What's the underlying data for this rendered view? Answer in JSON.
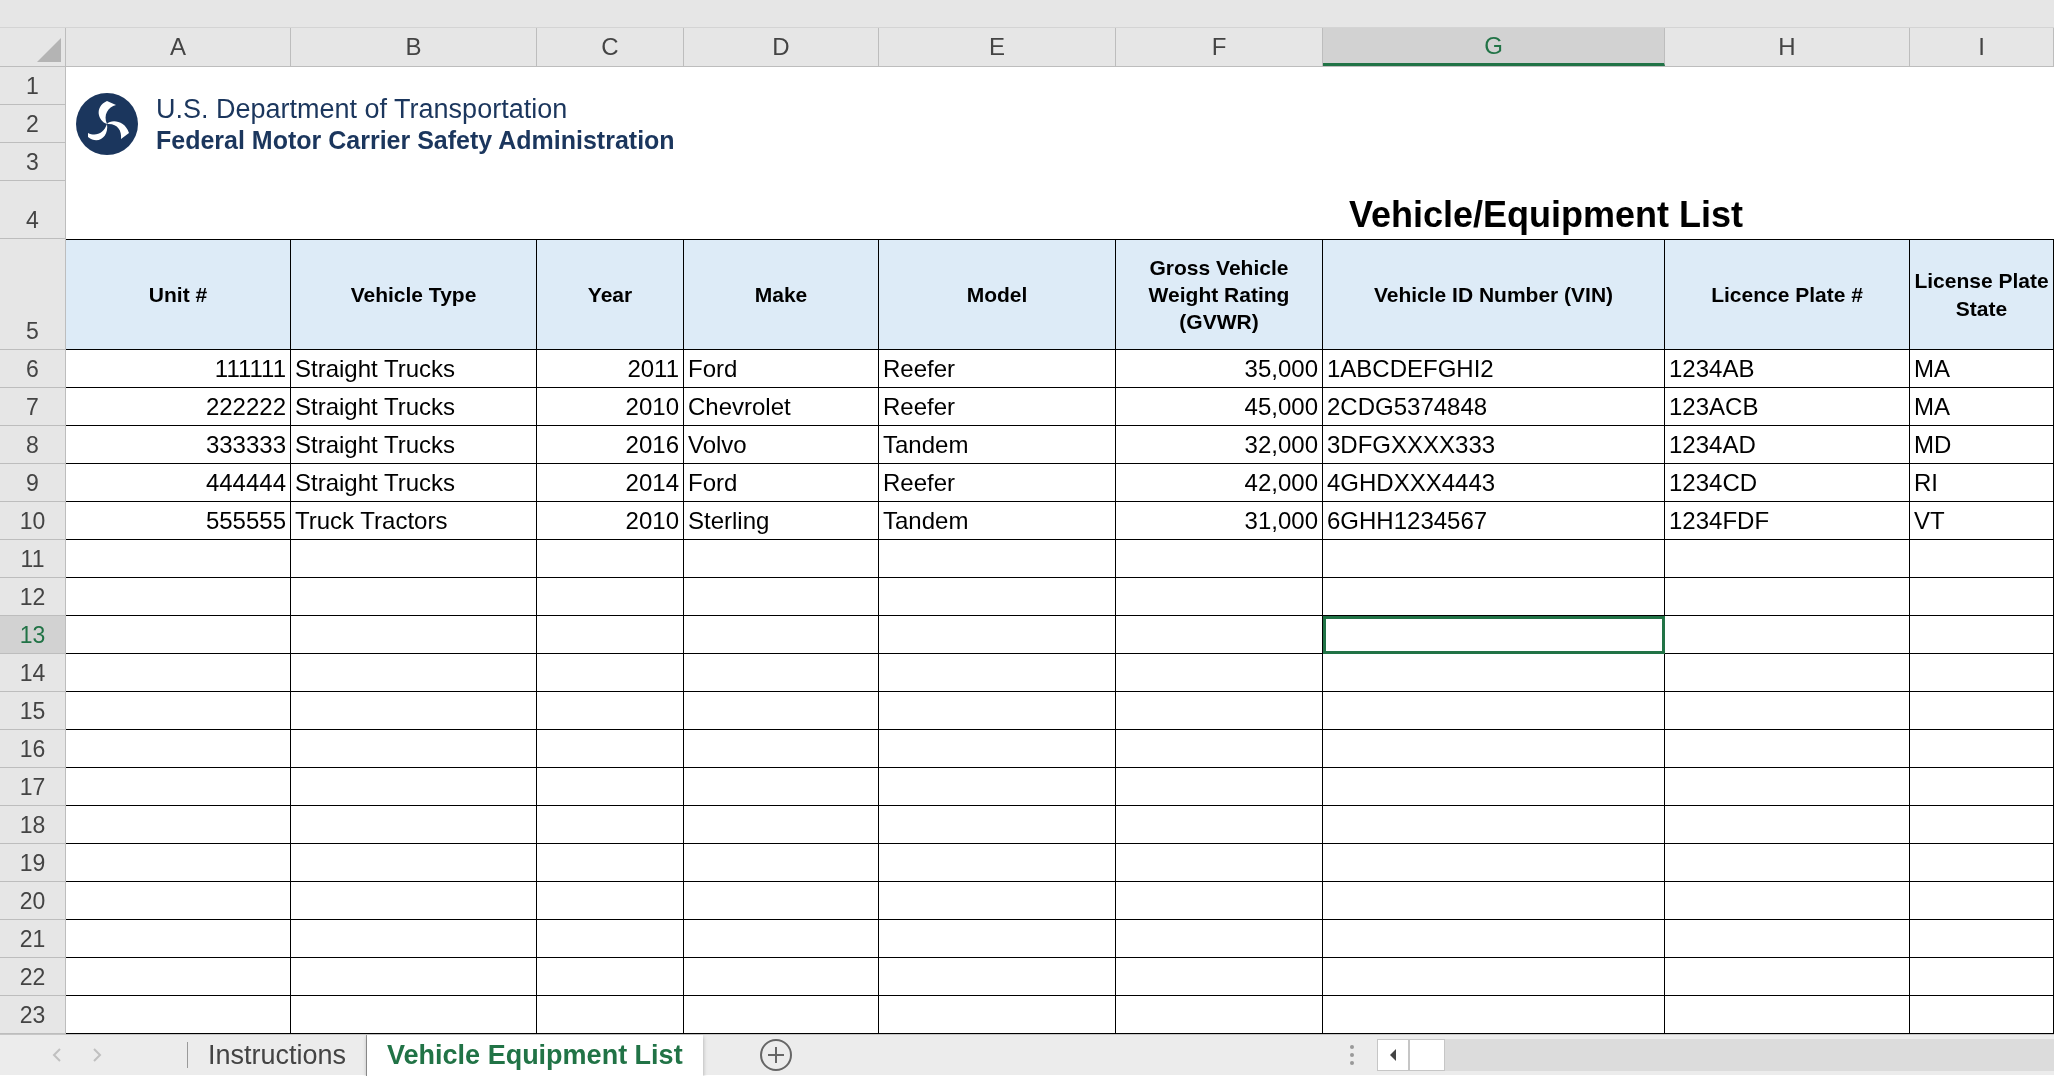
{
  "column_headers": [
    {
      "label": "A",
      "selected": false
    },
    {
      "label": "B",
      "selected": false
    },
    {
      "label": "C",
      "selected": false
    },
    {
      "label": "D",
      "selected": false
    },
    {
      "label": "E",
      "selected": false
    },
    {
      "label": "F",
      "selected": false
    },
    {
      "label": "G",
      "selected": true
    },
    {
      "label": "H",
      "selected": false
    },
    {
      "label": "I",
      "selected": false
    }
  ],
  "row_numbers": [
    {
      "label": "1",
      "selected": false
    },
    {
      "label": "2",
      "selected": false
    },
    {
      "label": "3",
      "selected": false
    },
    {
      "label": "4",
      "selected": false
    },
    {
      "label": "5",
      "selected": false
    },
    {
      "label": "6",
      "selected": false
    },
    {
      "label": "7",
      "selected": false
    },
    {
      "label": "8",
      "selected": false
    },
    {
      "label": "9",
      "selected": false
    },
    {
      "label": "10",
      "selected": false
    },
    {
      "label": "11",
      "selected": false
    },
    {
      "label": "12",
      "selected": false
    },
    {
      "label": "13",
      "selected": true
    },
    {
      "label": "14",
      "selected": false
    },
    {
      "label": "15",
      "selected": false
    },
    {
      "label": "16",
      "selected": false
    },
    {
      "label": "17",
      "selected": false
    },
    {
      "label": "18",
      "selected": false
    },
    {
      "label": "19",
      "selected": false
    },
    {
      "label": "20",
      "selected": false
    },
    {
      "label": "21",
      "selected": false
    },
    {
      "label": "22",
      "selected": false
    },
    {
      "label": "23",
      "selected": false
    }
  ],
  "logo": {
    "line_1": "U.S. Department of Transportation",
    "line_2": "Federal Motor Carrier Safety Administration"
  },
  "title": "Vehicle/Equipment List",
  "table": {
    "columns": [
      {
        "label": "Unit #",
        "kind": "number"
      },
      {
        "label": "Vehicle Type",
        "kind": "text"
      },
      {
        "label": "Year",
        "kind": "number"
      },
      {
        "label": "Make",
        "kind": "text"
      },
      {
        "label": "Model",
        "kind": "text"
      },
      {
        "label": "Gross Vehicle Weight Rating (GVWR)",
        "kind": "number"
      },
      {
        "label": "Vehicle ID Number (VIN)",
        "kind": "text"
      },
      {
        "label": "Licence Plate #",
        "kind": "text"
      },
      {
        "label": "License Plate State",
        "kind": "text"
      }
    ],
    "rows": [
      [
        "111111",
        "Straight Trucks",
        "2011",
        "Ford",
        "Reefer",
        "35,000",
        "1ABCDEFGHI2",
        "1234AB",
        "MA"
      ],
      [
        "222222",
        "Straight Trucks",
        "2010",
        "Chevrolet",
        "Reefer",
        "45,000",
        "2CDG5374848",
        "123ACB",
        "MA"
      ],
      [
        "333333",
        "Straight Trucks",
        "2016",
        "Volvo",
        "Tandem",
        "32,000",
        "3DFGXXXX333",
        "1234AD",
        "MD"
      ],
      [
        "444444",
        "Straight Trucks",
        "2014",
        "Ford",
        "Reefer",
        "42,000",
        "4GHDXXX4443",
        "1234CD",
        "RI"
      ],
      [
        "555555",
        "Truck Tractors",
        "2010",
        "Sterling",
        "Tandem",
        "31,000",
        "6GHH1234567",
        "1234FDF",
        "VT"
      ]
    ]
  },
  "sheet_tabs": [
    {
      "label": "Instructions",
      "selected": false
    },
    {
      "label": "Vehicle Equipment List",
      "selected": true
    }
  ]
}
